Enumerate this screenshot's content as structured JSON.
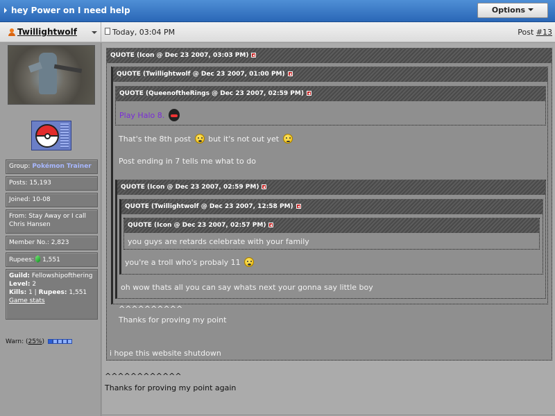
{
  "topic": {
    "title": "hey Power on I need help",
    "options_label": "Options"
  },
  "post": {
    "username": "Twillightwolf",
    "timestamp": "Today, 03:04 PM",
    "post_label": "Post",
    "post_number": "#13"
  },
  "sidebar": {
    "group_label": "Group:",
    "group_value": "Pokémon Trainer",
    "posts": "Posts: 15,193",
    "joined": "Joined: 10-08",
    "from": "From: Stay Away or I call Chris Hansen",
    "member_no": "Member No.: 2,823",
    "rupees_label": "Rupees:",
    "rupees_value": "1,551",
    "guild_label": "Guild:",
    "guild_value": "Fellowshipofthering",
    "level_label": "Level:",
    "level_value": "2",
    "kills_label": "Kills:",
    "kills_value": "1",
    "rupees2_label": "Rupees:",
    "rupees2_value": "1,551",
    "game_stats": "Game stats",
    "warn_label": "Warn: (",
    "warn_pct": "25%",
    "warn_close": ")",
    "warn_level": 0.25
  },
  "quotes": {
    "q1_head": "QUOTE (Icon @ Dec 23 2007, 03:03 PM)",
    "q2_head": "QUOTE (Twillightwolf @ Dec 23 2007, 01:00 PM)",
    "q3_head": "QUOTE (QueenoftheRings @ Dec 23 2007, 02:59 PM)",
    "q3_text": "Play Halo 8.",
    "q2_text1a": "That's the 8th post",
    "q2_text1b": "but it's not out yet",
    "q2_text2": "Post ending in 7 tells me what to do",
    "q4_head": "QUOTE (Icon @ Dec 23 2007, 02:59 PM)",
    "q5_head": "QUOTE (Twillightwolf @ Dec 23 2007, 12:58 PM)",
    "q6_head": "QUOTE (Icon @ Dec 23 2007, 02:57 PM)",
    "q6_text": "you guys are retards celebrate with your family",
    "q5_text": "you're a troll who's probaly 11",
    "q4_text": "oh wow thats all you can say whats next your gonna say little boy",
    "q1_carets": "^^^^^^^^^^",
    "q1_text": "Thanks for proving my point",
    "q0_text": "i hope this website shutdown"
  },
  "reply": {
    "carets": "^^^^^^^^^^^^",
    "text": "Thanks for proving my point again"
  },
  "colors": {
    "titlebar": "#2a67b7",
    "group": "#a8b8ff",
    "purple_text": "#7a2bd8"
  }
}
